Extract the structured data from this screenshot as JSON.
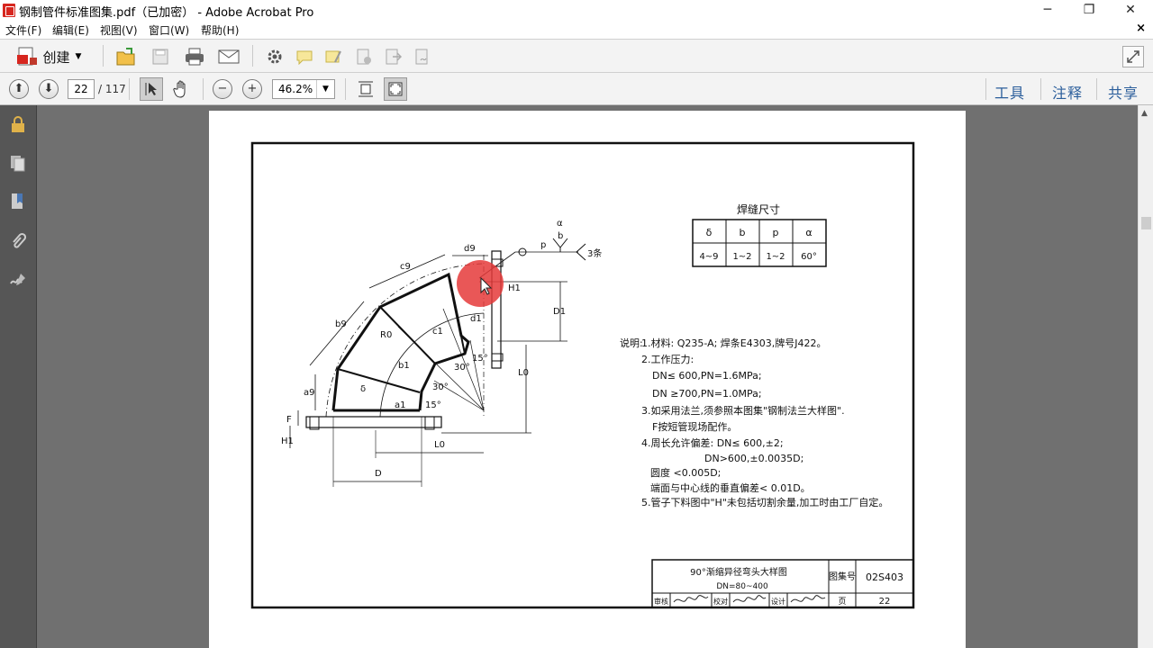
{
  "window": {
    "title": "钢制管件标准图集.pdf（已加密） - Adobe Acrobat Pro",
    "minimize": "─",
    "maximize": "❐",
    "close": "✕"
  },
  "menu": {
    "items": [
      "文件(F)",
      "编辑(E)",
      "视图(V)",
      "窗口(W)",
      "帮助(H)"
    ],
    "close_doc": "×"
  },
  "toolbar1": {
    "create_label": "创建"
  },
  "toolbar2": {
    "page_current": "22",
    "page_total": "/ 117",
    "zoom": "46.2%",
    "tools_label": "工具",
    "comment_label": "注释",
    "share_label": "共享"
  },
  "colors": {
    "accent": "#2b5e9b",
    "doc_bg": "#707070",
    "sidebar_bg": "#565656",
    "cursor_highlight": "#e53a3a"
  },
  "drawing": {
    "weld_table_title": "焊缝尺寸",
    "weld_headers": [
      "δ",
      "b",
      "p",
      "α"
    ],
    "weld_values": [
      "4~9",
      "1~2",
      "1~2",
      "60°"
    ],
    "labels": {
      "c9": "c9",
      "d9_top": "d9",
      "b9": "b9",
      "a9": "a9",
      "R0": "R0",
      "c1": "c1",
      "d1": "d1",
      "b1": "b1",
      "a1": "a1",
      "delta": "δ",
      "deg30a": "30°",
      "deg30b": "30°",
      "deg15a": "15°",
      "deg15b": "15°",
      "H1_top": "H1",
      "D1": "D1",
      "L0_v": "L0",
      "L0_h": "L0",
      "D": "D",
      "H1_left": "H1",
      "F": "F",
      "alpha": "α",
      "b_sym": "b",
      "p_sym": "p",
      "three": "3条"
    },
    "notes": {
      "heading": "说明:",
      "n1": "1.材料: Q235-A; 焊条E4303,牌号J422。",
      "n2": "2.工作压力:",
      "n2a": "DN≤ 600,PN=1.6MPa;",
      "n2b": "DN ≥700,PN=1.0MPa;",
      "n3": "3.如采用法兰,须参照本图集\"钢制法兰大样图\".",
      "n3a": "F按短管现场配作。",
      "n4": "4.周长允许偏差: DN≤ 600,±2;",
      "n4a": "DN>600,±0.0035D;",
      "n4b": "圆度 <0.005D;",
      "n4c": "端面与中心线的垂直偏差< 0.01D。",
      "n5": "5.管子下料图中\"H\"未包括切割余量,加工时由工厂自定。"
    },
    "titleblock": {
      "name": "90°渐缩异径弯头大样图",
      "range": "DN=80~400",
      "set_no_label": "图集号",
      "set_no": "02S403",
      "page_label": "页",
      "page_no": "22",
      "review": "审核",
      "check": "校对",
      "design": "设计"
    }
  }
}
